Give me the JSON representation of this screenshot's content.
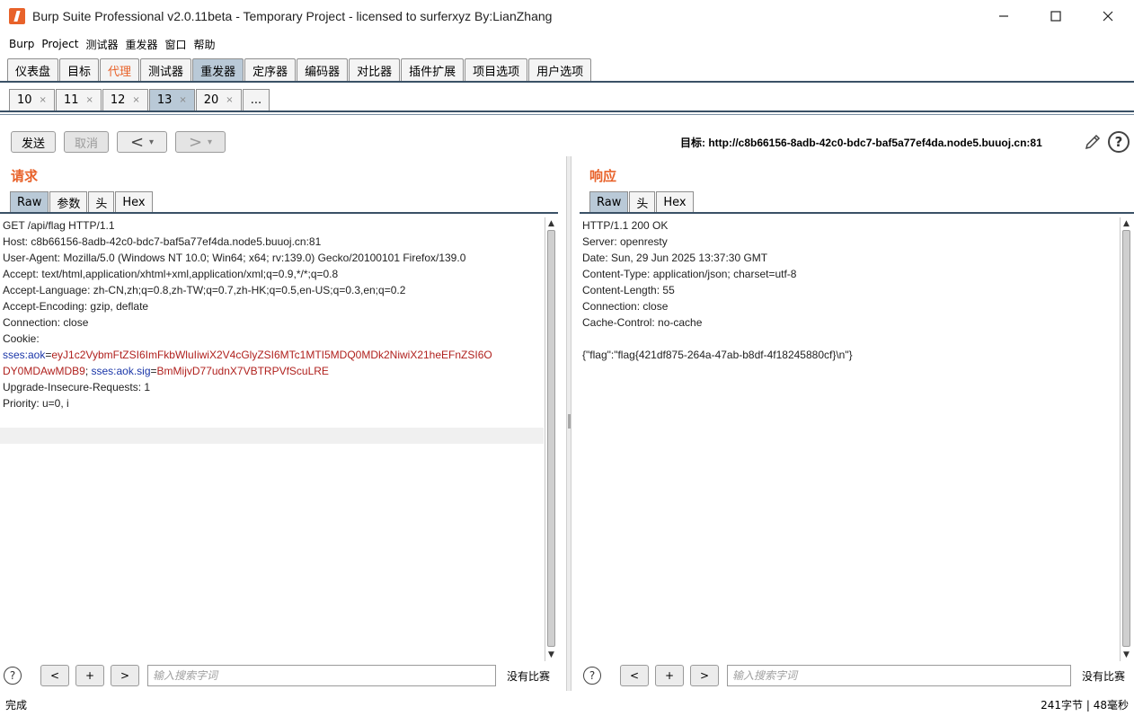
{
  "window": {
    "title": "Burp Suite Professional v2.0.11beta - Temporary Project - licensed to surferxyz By:LianZhang"
  },
  "menu": [
    "Burp",
    "Project",
    "测试器",
    "重发器",
    "窗口",
    "帮助"
  ],
  "main_tabs": [
    {
      "label": "仪表盘"
    },
    {
      "label": "目标"
    },
    {
      "label": "代理"
    },
    {
      "label": "测试器"
    },
    {
      "label": "重发器"
    },
    {
      "label": "定序器"
    },
    {
      "label": "编码器"
    },
    {
      "label": "对比器"
    },
    {
      "label": "插件扩展"
    },
    {
      "label": "项目选项"
    },
    {
      "label": "用户选项"
    }
  ],
  "sub_tabs": [
    {
      "label": "10",
      "close": "×"
    },
    {
      "label": "11",
      "close": "×"
    },
    {
      "label": "12",
      "close": "×"
    },
    {
      "label": "13",
      "close": "×"
    },
    {
      "label": "20",
      "close": "×"
    },
    {
      "label": "...",
      "close": ""
    }
  ],
  "toolbar": {
    "send": "发送",
    "cancel": "取消",
    "back": "<",
    "forward": ">",
    "dropdown": "▾",
    "target": "目标: http://c8b66156-8adb-42c0-bdc7-baf5a77ef4da.node5.buuoj.cn:81",
    "help": "?"
  },
  "request": {
    "title": "请求",
    "tabs": [
      "Raw",
      "参数",
      "头",
      "Hex"
    ],
    "lines": [
      "GET /api/flag HTTP/1.1",
      "Host: c8b66156-8adb-42c0-bdc7-baf5a77ef4da.node5.buuoj.cn:81",
      "User-Agent: Mozilla/5.0 (Windows NT 10.0; Win64; x64; rv:139.0) Gecko/20100101 Firefox/139.0",
      "Accept: text/html,application/xhtml+xml,application/xml;q=0.9,*/*;q=0.8",
      "Accept-Language: zh-CN,zh;q=0.8,zh-TW;q=0.7,zh-HK;q=0.5,en-US;q=0.3,en;q=0.2",
      "Accept-Encoding: gzip, deflate",
      "Connection: close",
      "Cookie:"
    ],
    "cookie": {
      "name1": "sses:aok",
      "eq1": "=",
      "value1a": "eyJ1c2VybmFtZSI6ImFkbWluIiwiX2V4cGlyZSI6MTc1MTI5MDQ0MDk2NiwiX21heEFnZSI6O",
      "value1b": "DY0MDAwMDB9",
      "sep": "; ",
      "name2": "sses:aok.sig",
      "eq2": "=",
      "value2": "BmMijvD77udnX7VBTRPVfScuLRE"
    },
    "lines_after": [
      "Upgrade-Insecure-Requests: 1",
      "Priority: u=0, i"
    ]
  },
  "response": {
    "title": "响应",
    "tabs": [
      "Raw",
      "头",
      "Hex"
    ],
    "lines": [
      "HTTP/1.1 200 OK",
      "Server: openresty",
      "Date: Sun, 29 Jun 2025 13:37:30 GMT",
      "Content-Type: application/json; charset=utf-8",
      "Content-Length: 55",
      "Connection: close",
      "Cache-Control: no-cache",
      "",
      "{\"flag\":\"flag{421df875-264a-47ab-b8df-4f18245880cf}\\n\"}"
    ]
  },
  "search": {
    "help": "?",
    "prev": "<",
    "add": "+",
    "next": ">",
    "placeholder": "输入搜索字词",
    "matches": "没有比赛"
  },
  "scroll": {
    "up": "▲",
    "down": "▼"
  },
  "status": {
    "left": "完成",
    "right": "241字节 | 48毫秒"
  },
  "colors": {
    "accent": "#e8622a",
    "active_tab": "#b9c9d7",
    "cookie_name": "#1a36a8",
    "cookie_value": "#b0211e"
  }
}
